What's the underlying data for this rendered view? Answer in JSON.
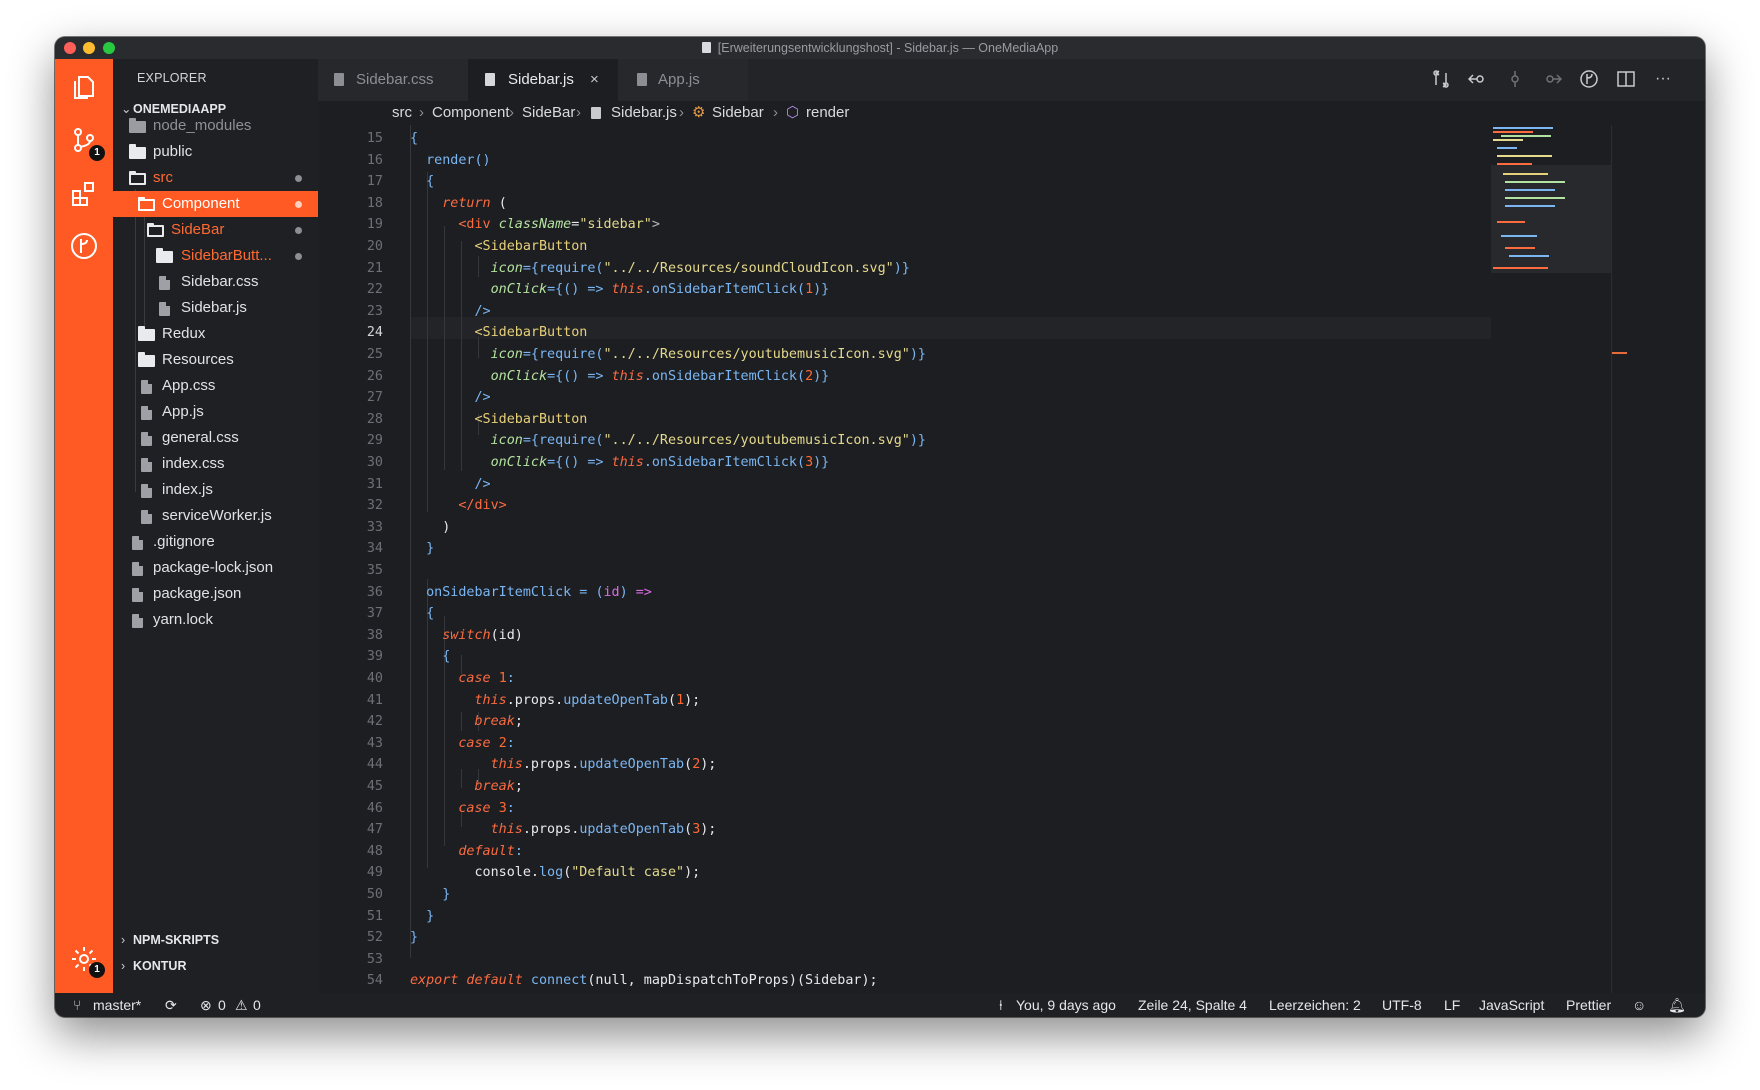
{
  "window": {
    "title": "[Erweiterungsentwicklungshost] - Sidebar.js — OneMediaApp"
  },
  "activity_bar": {
    "items": [
      {
        "icon": "files-icon"
      },
      {
        "icon": "source-control-icon",
        "badge": "1"
      },
      {
        "icon": "extensions-icon"
      },
      {
        "icon": "git-graph-icon"
      }
    ],
    "settings": {
      "icon": "settings-gear-icon",
      "badge": "1"
    }
  },
  "explorer": {
    "header": "EXPLORER",
    "root": "ONEMEDIAAPP",
    "tree": [
      {
        "label": "node_modules",
        "type": "folder"
      },
      {
        "label": "public",
        "type": "folder"
      },
      {
        "label": "src",
        "type": "folder-open"
      },
      {
        "label": "Component",
        "type": "folder-open"
      },
      {
        "label": "SideBar",
        "type": "folder-open"
      },
      {
        "label": "SidebarButt...",
        "type": "folder"
      },
      {
        "label": "Sidebar.css",
        "type": "file"
      },
      {
        "label": "Sidebar.js",
        "type": "file"
      },
      {
        "label": "Redux",
        "type": "folder"
      },
      {
        "label": "Resources",
        "type": "folder"
      },
      {
        "label": "App.css",
        "type": "file"
      },
      {
        "label": "App.js",
        "type": "file"
      },
      {
        "label": "general.css",
        "type": "file"
      },
      {
        "label": "index.css",
        "type": "file"
      },
      {
        "label": "index.js",
        "type": "file"
      },
      {
        "label": "serviceWorker.js",
        "type": "file"
      },
      {
        "label": ".gitignore",
        "type": "file"
      },
      {
        "label": "package-lock.json",
        "type": "file"
      },
      {
        "label": "package.json",
        "type": "file"
      },
      {
        "label": "yarn.lock",
        "type": "file"
      }
    ],
    "sections": [
      "NPM-SKRIPTS",
      "KONTUR"
    ]
  },
  "tabs": [
    {
      "label": "Sidebar.css",
      "active": false
    },
    {
      "label": "Sidebar.js",
      "active": true,
      "close": "×"
    },
    {
      "label": "App.js",
      "active": false
    }
  ],
  "toolbar": {
    "more": "···"
  },
  "breadcrumb": [
    "src",
    "Component",
    "SideBar",
    "Sidebar.js",
    "Sidebar",
    "render"
  ],
  "editor": {
    "current_line": "24",
    "line_numbers": [
      "15",
      "16",
      "17",
      "18",
      "19",
      "20",
      "21",
      "22",
      "23",
      "24",
      "25",
      "26",
      "27",
      "28",
      "29",
      "30",
      "31",
      "32",
      "33",
      "34",
      "35",
      "36",
      "37",
      "38",
      "39",
      "40",
      "41",
      "42",
      "43",
      "44",
      "45",
      "46",
      "47",
      "48",
      "49",
      "50",
      "51",
      "52",
      "53",
      "54"
    ],
    "code": {
      "l15_brace": "{",
      "l16_render": "render",
      "l16_parens": "()",
      "l17_brace": "{",
      "l18_return": "return",
      "l18_paren": "(",
      "l19_div_open": "<div",
      "l19_attr": "className",
      "l19_eq": "=",
      "l19_val": "\"sidebar\"",
      "l19_close": ">",
      "btn1_tag": "<SidebarButton",
      "btn1_icon_attr": "icon",
      "btn1_icon_pre": "={require(",
      "btn1_icon_str": "\"../../Resources/soundCloudIcon.svg\"",
      "btn1_icon_post": ")}",
      "btn1_click_attr": "onClick",
      "btn1_click_pre": "={() => ",
      "btn1_this": "this",
      "btn1_method": ".onSidebarItemClick",
      "btn1_arg_open": "(",
      "btn1_arg": "1",
      "btn1_arg_close": ")}",
      "btn1_end": "/>",
      "btn2_tag": "<SidebarButton",
      "btn2_icon_attr": "icon",
      "btn2_icon_pre": "={require(",
      "btn2_icon_str": "\"../../Resources/youtubemusicIcon.svg\"",
      "btn2_icon_post": ")}",
      "btn2_click_attr": "onClick",
      "btn2_click_pre": "={() => ",
      "btn2_this": "this",
      "btn2_method": ".onSidebarItemClick",
      "btn2_arg_open": "(",
      "btn2_arg": "2",
      "btn2_arg_close": ")}",
      "btn2_end": "/>",
      "btn3_tag": "<SidebarButton",
      "btn3_icon_attr": "icon",
      "btn3_icon_pre": "={require(",
      "btn3_icon_str": "\"../../Resources/youtubemusicIcon.svg\"",
      "btn3_icon_post": ")}",
      "btn3_click_attr": "onClick",
      "btn3_click_pre": "={() => ",
      "btn3_this": "this",
      "btn3_method": ".onSidebarItemClick",
      "btn3_arg_open": "(",
      "btn3_arg": "3",
      "btn3_arg_close": ")}",
      "btn3_end": "/>",
      "l32_div_close": "</div>",
      "l33_paren": ")",
      "l34_brace": "}",
      "l36_name": "onSidebarItemClick",
      "l36_eq": " = ",
      "l36_params_open": "(",
      "l36_param": "id",
      "l36_params_close": ")",
      "l36_arrow": " =>",
      "l37_brace": "{",
      "l38_switch": "switch",
      "l38_args": "(id)",
      "l39_brace": "{",
      "case1_kw": "case",
      "case1_num": "1",
      "case1_colon": ":",
      "case1_this": "this",
      "case1_props": ".props.",
      "case1_fn": "updateOpenTab",
      "case1_arg_open": "(",
      "case1_arg": "1",
      "case1_arg_close": ");",
      "case1_break": "break",
      "case1_semi": ";",
      "case2_kw": "case",
      "case2_num": "2",
      "case2_colon": ":",
      "case2_this": "this",
      "case2_props": ".props.",
      "case2_fn": "updateOpenTab",
      "case2_arg_open": "(",
      "case2_arg": "2",
      "case2_arg_close": ");",
      "case2_break": "break",
      "case2_semi": ";",
      "case3_kw": "case",
      "case3_num": "3",
      "case3_colon": ":",
      "case3_this": "this",
      "case3_props": ".props.",
      "case3_fn": "updateOpenTab",
      "case3_arg_open": "(",
      "case3_arg": "3",
      "case3_arg_close": ");",
      "l48_default": "default",
      "l48_colon": ":",
      "l49_console": "console.",
      "l49_log": "log",
      "l49_open": "(",
      "l49_str": "\"Default case\"",
      "l49_close": ");",
      "l50_brace": "}",
      "l51_brace": "}",
      "l52_brace": "}",
      "l54_export": "export default",
      "l54_connect": " connect",
      "l54_rest": "(null, mapDispatchToProps)(Sidebar);"
    }
  },
  "statusbar": {
    "branch": "master*",
    "errors": "0",
    "warnings": "0",
    "blame": "You, 9 days ago",
    "position": "Zeile 24, Spalte 4",
    "indent": "Leerzeichen: 2",
    "encoding": "UTF-8",
    "eol": "LF",
    "language": "JavaScript",
    "formatter": "Prettier"
  },
  "colors": {
    "accent": "#ff5a23",
    "background": "#1d1e22",
    "keyword": "#fb6b40",
    "string": "#e4d98c",
    "function": "#7bb6f2"
  }
}
